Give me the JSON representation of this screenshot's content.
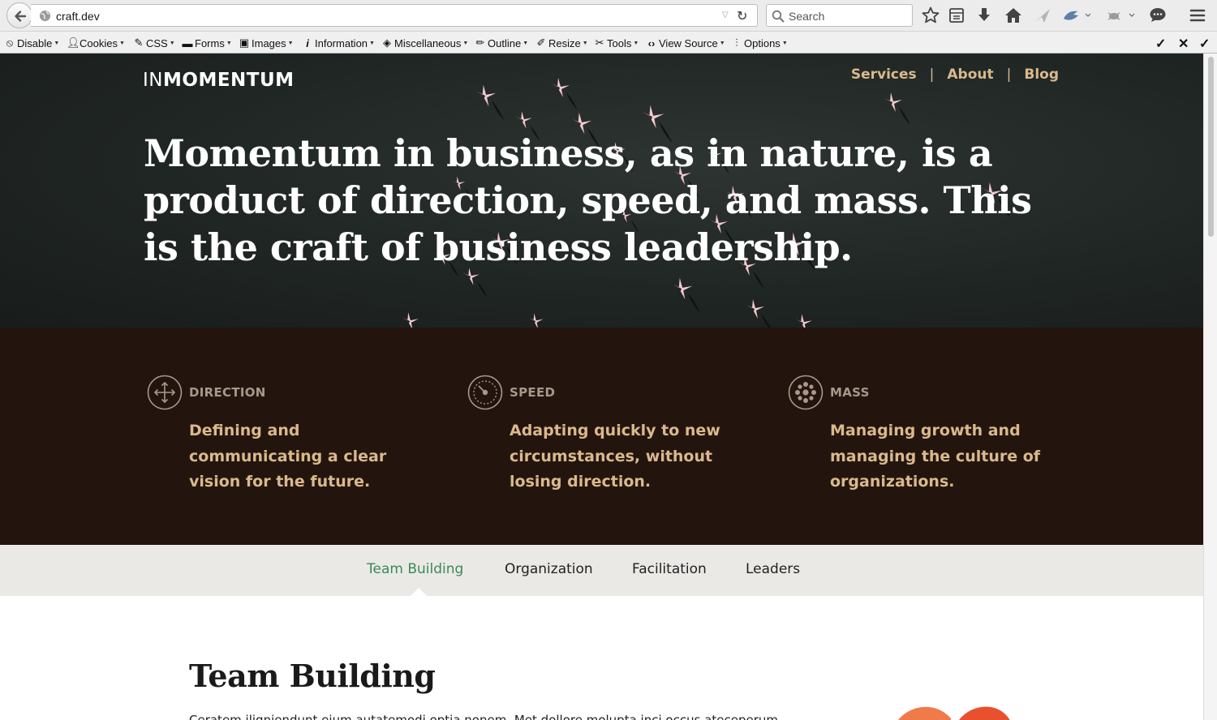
{
  "browser": {
    "url": "craft.dev",
    "search_placeholder": "Search",
    "devtools": [
      {
        "label": "Disable",
        "icon": "no-entry-icon"
      },
      {
        "label": "Cookies",
        "icon": "person-icon"
      },
      {
        "label": "CSS",
        "icon": "magic-wand-icon"
      },
      {
        "label": "Forms",
        "icon": "briefcase-icon"
      },
      {
        "label": "Images",
        "icon": "image-icon"
      },
      {
        "label": "Information",
        "icon": "info-icon"
      },
      {
        "label": "Miscellaneous",
        "icon": "cube-icon"
      },
      {
        "label": "Outline",
        "icon": "pencil-icon"
      },
      {
        "label": "Resize",
        "icon": "resize-icon"
      },
      {
        "label": "Tools",
        "icon": "wrench-icon"
      },
      {
        "label": "View Source",
        "icon": "code-icon"
      },
      {
        "label": "Options",
        "icon": "sliders-icon"
      }
    ]
  },
  "site": {
    "logo_light": "IN",
    "logo_bold": "MOMENTUM",
    "nav": [
      "Services",
      "About",
      "Blog"
    ],
    "nav_separator": "|",
    "headline": "Momentum in business, as in nature, is a product of direction, speed, and mass. This is the craft of business leadership."
  },
  "pillars": [
    {
      "title": "DIRECTION",
      "icon": "move-arrows-icon",
      "desc": "Defining and communicating a clear vision for the future."
    },
    {
      "title": "SPEED",
      "icon": "speedometer-icon",
      "desc": "Adapting quickly to new circumstances, without losing direction."
    },
    {
      "title": "MASS",
      "icon": "dots-cluster-icon",
      "desc": "Managing growth and managing the culture of organizations."
    }
  ],
  "tabs": {
    "items": [
      "Team Building",
      "Organization",
      "Facilitation",
      "Leaders"
    ],
    "active": "Team Building"
  },
  "content": {
    "title": "Team Building",
    "body": "Ceratem iligniendunt eium autatemodi optia nonem. Met dollore molupta inci occus ateceperum"
  },
  "colors": {
    "accent_gold": "#d9b98c",
    "dark_brown": "#23150e",
    "tab_active_green": "#3a8a57",
    "tab_bar_bg": "#eae9e6"
  }
}
